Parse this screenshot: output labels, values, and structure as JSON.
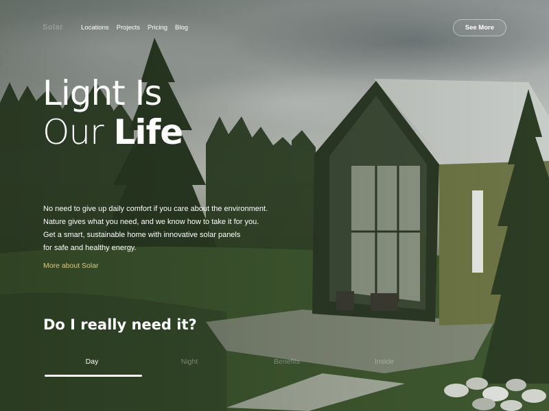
{
  "nav": {
    "logo": "Solar",
    "links": [
      "Locations",
      "Projects",
      "Pricing",
      "Blog"
    ],
    "cta": "See More"
  },
  "hero": {
    "title_line1": "Light Is",
    "title_line2_light": "Our",
    "title_line2_bold": "Life",
    "description_lines": [
      "No need to give up daily comfort if you care about the environment.",
      "Nature gives what you need, and we know how to take it for you.",
      "Get a smart, sustainable home with innovative solar panels",
      "for safe and healthy energy."
    ],
    "more_link": "More about Solar"
  },
  "section": {
    "question": "Do I really need it?",
    "tabs": [
      {
        "label": "Day",
        "active": true
      },
      {
        "label": "Night",
        "active": false
      },
      {
        "label": "Benefits",
        "active": false
      },
      {
        "label": "Inside",
        "active": false
      }
    ]
  },
  "colors": {
    "accent_link": "#d9c98d",
    "text": "#ffffff"
  }
}
